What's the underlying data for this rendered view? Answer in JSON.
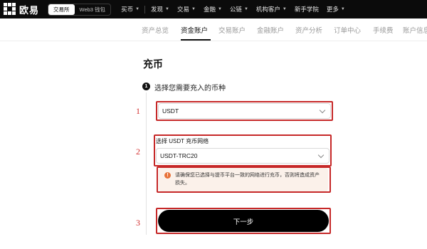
{
  "topnav": {
    "logo_text": "欧易",
    "mode_tabs": [
      "交易所",
      "Web3 钱包"
    ],
    "items": [
      {
        "label": "买币",
        "has_menu": true
      },
      {
        "label": "发现",
        "has_menu": true
      },
      {
        "label": "交易",
        "has_menu": true
      },
      {
        "label": "金融",
        "has_menu": true
      },
      {
        "label": "公链",
        "has_menu": true
      },
      {
        "label": "机构客户",
        "has_menu": true
      },
      {
        "label": "新手学院",
        "has_menu": false
      },
      {
        "label": "更多",
        "has_menu": true
      }
    ]
  },
  "subnav": {
    "items": [
      "资产总览",
      "资金账户",
      "交易账户",
      "金融账户",
      "资产分析",
      "订单中心",
      "手续费",
      "账户信息"
    ],
    "active": "资金账户"
  },
  "page": {
    "title": "充币",
    "step1_number": "1",
    "step1_label": "选择您需要充入的币种",
    "coin_select_value": "USDT",
    "network_label": "选择 USDT 充币网络",
    "network_select_value": "USDT-TRC20",
    "warning_text": "请确保您已选择与提币平台一致的网络进行充币，否则将造成资产损失。",
    "next_button": "下一步"
  },
  "annotations": {
    "marks": [
      "1",
      "2",
      "3"
    ],
    "color": "#c62828"
  },
  "colors": {
    "topbar_bg": "#0b0b0b",
    "primary_button": "#000000",
    "warning_bg": "#fbf1ea",
    "warning_icon": "#e8733a"
  },
  "icons": [
    "logo-mark-icon",
    "chevron-down-icon",
    "warning-icon"
  ]
}
